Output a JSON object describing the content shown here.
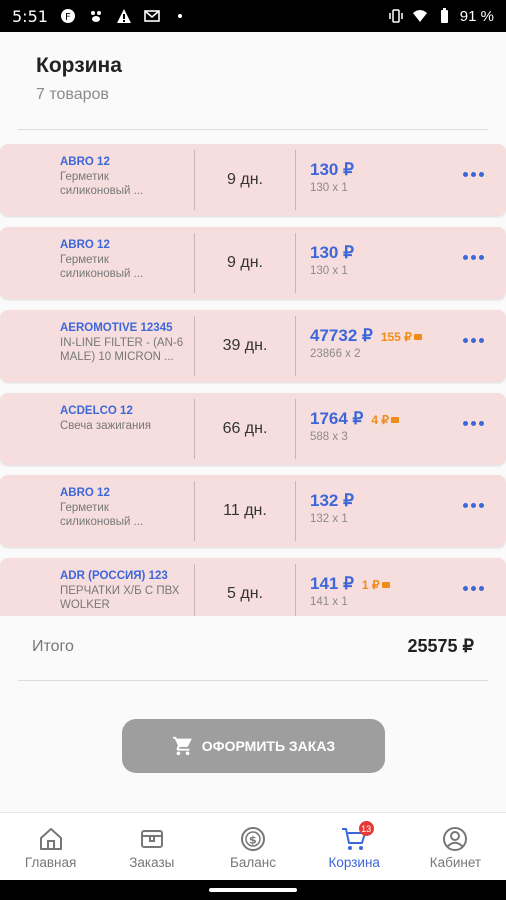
{
  "status_bar": {
    "time": "5:51",
    "battery": "91 %"
  },
  "header": {
    "title": "Корзина",
    "subtitle": "7 товаров"
  },
  "items": [
    {
      "brand": "ABRO 12",
      "desc_line1": "Герметик",
      "desc_line2": "силиконовый ...",
      "days": "9 дн.",
      "price": "130 ₽",
      "bonus": "",
      "qty": "130 x 1"
    },
    {
      "brand": "ABRO 12",
      "desc_line1": "Герметик",
      "desc_line2": "силиконовый ...",
      "days": "9 дн.",
      "price": "130 ₽",
      "bonus": "",
      "qty": "130 x 1"
    },
    {
      "brand": "AEROMOTIVE 12345",
      "desc_line1": "IN-LINE FILTER - (AN-6",
      "desc_line2": "MALE) 10 MICRON ...",
      "days": "39 дн.",
      "price": "47732 ₽",
      "bonus": "155 ₽",
      "qty": "23866 x 2"
    },
    {
      "brand": "ACDELCO 12",
      "desc_line1": "Свеча зажигания",
      "desc_line2": "",
      "days": "66 дн.",
      "price": "1764 ₽",
      "bonus": "4 ₽",
      "qty": "588 x 3"
    },
    {
      "brand": "ABRO 12",
      "desc_line1": "Герметик",
      "desc_line2": "силиконовый ...",
      "days": "11 дн.",
      "price": "132 ₽",
      "bonus": "",
      "qty": "132 x 1"
    },
    {
      "brand": "ADR (РОССИЯ) 123",
      "desc_line1": "ПЕРЧАТКИ Х/Б С ПВХ",
      "desc_line2": "WOLKER",
      "days": "5 дн.",
      "price": "141 ₽",
      "bonus": "1 ₽",
      "qty": "141 x 1"
    }
  ],
  "summary": {
    "total_label": "Итого",
    "total_value": "25575 ₽"
  },
  "order_button": {
    "label": "ОФОРМИТЬ ЗАКАЗ",
    "icon": "cart-icon"
  },
  "tabs": [
    {
      "label": "Главная",
      "icon": "home-icon"
    },
    {
      "label": "Заказы",
      "icon": "orders-icon"
    },
    {
      "label": "Баланс",
      "icon": "balance-icon"
    },
    {
      "label": "Корзина",
      "icon": "cart-icon",
      "badge": "13",
      "active": true
    },
    {
      "label": "Кабинет",
      "icon": "profile-icon"
    }
  ],
  "colors": {
    "accent": "#3d66d9",
    "item_bg": "#f7dede",
    "bonus": "#f08c1a",
    "button": "#9e9e9e",
    "badge": "#e53935"
  }
}
